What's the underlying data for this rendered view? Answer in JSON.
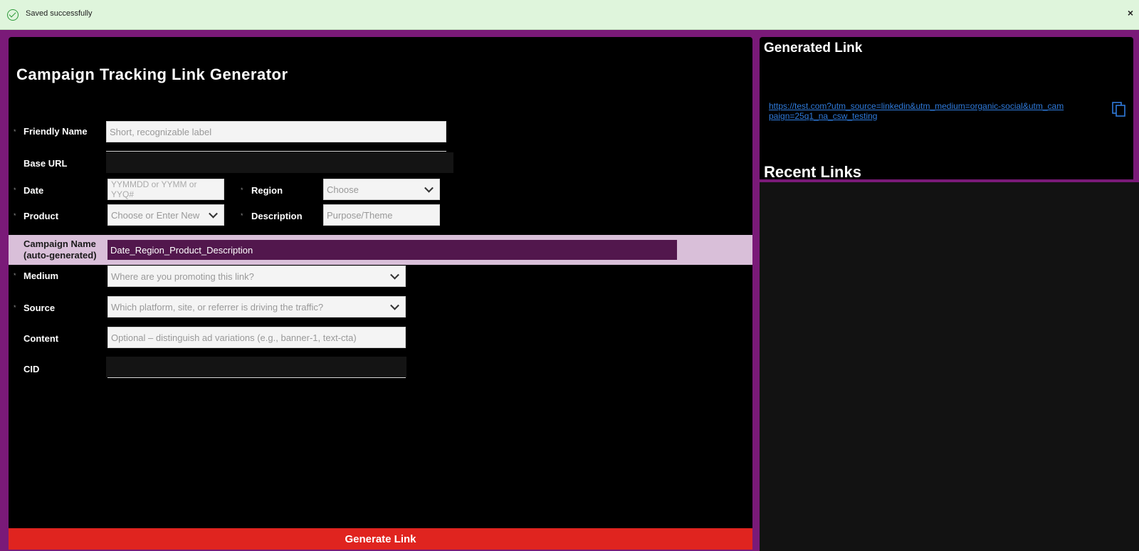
{
  "toast": {
    "message": "Saved successfully",
    "close": "×"
  },
  "form": {
    "title": "Campaign Tracking Link Generator",
    "friendly_name": {
      "label": "Friendly Name",
      "placeholder": "Short, recognizable label"
    },
    "base_url": {
      "label": "Base URL",
      "value": ""
    },
    "date": {
      "label": "Date",
      "placeholder": "YYMMDD or YYMM or YYQ#"
    },
    "region": {
      "label": "Region",
      "placeholder": "Choose"
    },
    "product": {
      "label": "Product",
      "placeholder": "Choose or Enter New"
    },
    "description": {
      "label": "Description",
      "placeholder": "Purpose/Theme"
    },
    "campaign_name": {
      "label_line1": "Campaign Name",
      "label_line2": "(auto-generated)",
      "value": "Date_Region_Product_Description"
    },
    "medium": {
      "label": "Medium",
      "placeholder": "Where are you promoting this link?"
    },
    "source": {
      "label": "Source",
      "placeholder": "Which platform, site, or referrer is driving the traffic?"
    },
    "content": {
      "label": "Content",
      "placeholder": "Optional – distinguish ad variations (e.g., banner-1, text-cta)"
    },
    "cid": {
      "label": "CID",
      "value": ""
    },
    "generate_label": "Generate Link",
    "required_marker": "*"
  },
  "generated": {
    "title": "Generated Link",
    "link": "https://test.com?utm_source=linkedin&utm_medium=organic-social&utm_campaign=25q1_na_csw_testing"
  },
  "recent": {
    "title": "Recent Links"
  },
  "colors": {
    "accent": "#7a1a78",
    "campaign_bg": "#52174d",
    "button": "#e0241f",
    "link": "#2f7bdc"
  }
}
